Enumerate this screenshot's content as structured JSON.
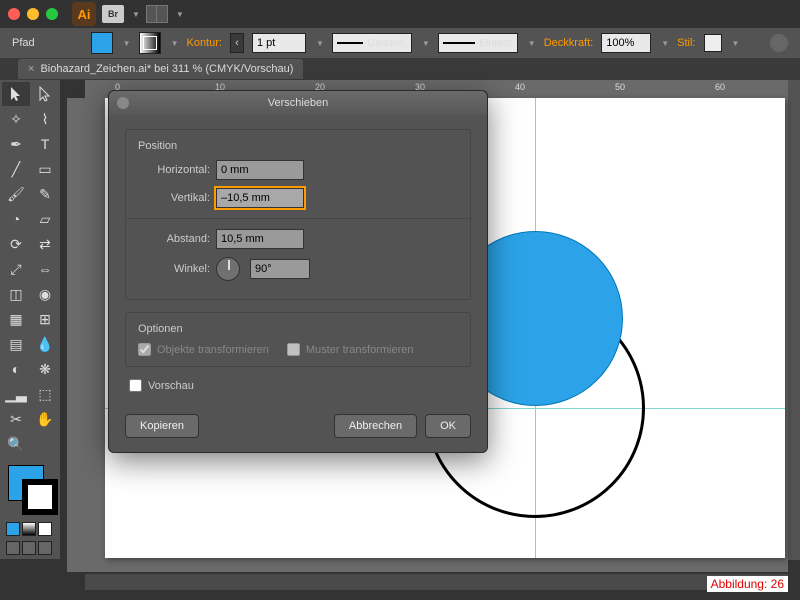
{
  "menubar": {
    "br": "Br"
  },
  "optbar": {
    "path": "Pfad",
    "kontur": "Kontur:",
    "weight": "1 pt",
    "cap_label": "Gleichm.",
    "corner_label": "Einfach",
    "deckkraft": "Deckkraft:",
    "opacity": "100%",
    "stil": "Stil:"
  },
  "tab": {
    "title": "Biohazard_Zeichen.ai* bei 311 % (CMYK/Vorschau)"
  },
  "ruler": {
    "m0": "0",
    "m10": "10",
    "m20": "20",
    "m30": "30",
    "m40": "40",
    "m50": "50",
    "m60": "60"
  },
  "dialog": {
    "title": "Verschieben",
    "position": "Position",
    "horizontal": "Horizontal:",
    "h_val": "0 mm",
    "vertikal": "Vertikal:",
    "v_val": "–10,5 mm",
    "abstand": "Abstand:",
    "a_val": "10,5 mm",
    "winkel": "Winkel:",
    "w_val": "90°",
    "optionen": "Optionen",
    "obj_trans": "Objekte transformieren",
    "muster_trans": "Muster transformieren",
    "vorschau": "Vorschau",
    "kopieren": "Kopieren",
    "abbrechen": "Abbrechen",
    "ok": "OK"
  },
  "caption": "Abbildung: 26"
}
